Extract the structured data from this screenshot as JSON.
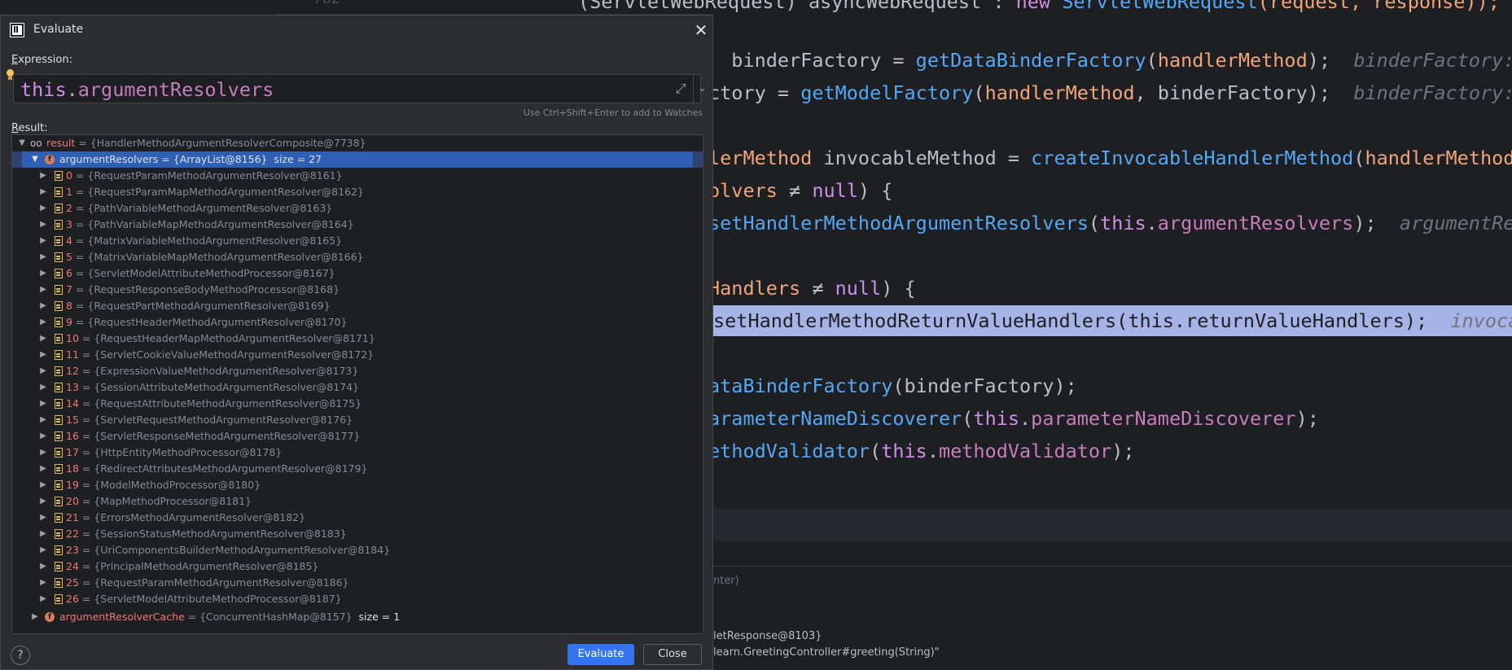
{
  "editor": {
    "top_gutter": [
      "782",
      "",
      ""
    ],
    "lines": [
      {
        "segments": [
          {
            "t": "(ServletWebRequest) asyncWebRequest : ",
            "c": ""
          },
          {
            "t": "new ",
            "c": "kw"
          },
          {
            "t": "ServletWebRequest",
            "c": "fn"
          },
          {
            "t": "(request, response));",
            "c": "par"
          }
        ]
      },
      {
        "segments": [
          {
            "t": "  binderFactory = ",
            "c": ""
          },
          {
            "t": "getDataBinderFactory",
            "c": "fn"
          },
          {
            "t": "(",
            "c": ""
          },
          {
            "t": "handlerMethod",
            "c": "par"
          },
          {
            "t": ");  ",
            "c": ""
          },
          {
            "t": "binderFactory: ",
            "c": "hint"
          }
        ]
      },
      {
        "segments": [
          {
            "t": "ctory = ",
            "c": ""
          },
          {
            "t": "getModelFactory",
            "c": "fn"
          },
          {
            "t": "(",
            "c": ""
          },
          {
            "t": "handlerMethod",
            "c": "par"
          },
          {
            "t": ", binderFactory);  ",
            "c": ""
          },
          {
            "t": "binderFactory:",
            "c": "hint"
          }
        ]
      },
      {
        "segments": [
          {
            "t": "lerMethod",
            "c": "par"
          },
          {
            "t": " invocableMethod = ",
            "c": ""
          },
          {
            "t": "createInvocableHandlerMethod",
            "c": "fn"
          },
          {
            "t": "(",
            "c": ""
          },
          {
            "t": "handlerMethod",
            "c": "par"
          }
        ]
      },
      {
        "segments": [
          {
            "t": "olvers",
            "c": "par"
          },
          {
            "t": " ≠ ",
            "c": ""
          },
          {
            "t": "null",
            "c": "kw"
          },
          {
            "t": ") {",
            "c": ""
          }
        ]
      },
      {
        "segments": [
          {
            "t": "setHandlerMethodArgumentResolvers",
            "c": "fn"
          },
          {
            "t": "(",
            "c": ""
          },
          {
            "t": "this",
            "c": "kw"
          },
          {
            "t": ".",
            "c": ""
          },
          {
            "t": "argumentResolvers",
            "c": "fld"
          },
          {
            "t": ");  ",
            "c": ""
          },
          {
            "t": "argumentRe",
            "c": "hint"
          }
        ]
      },
      {
        "segments": [
          {
            "t": "Handlers",
            "c": "par"
          },
          {
            "t": " ≠ ",
            "c": ""
          },
          {
            "t": "null",
            "c": "kw"
          },
          {
            "t": ") {",
            "c": ""
          }
        ]
      },
      {
        "segments": [
          {
            "t": "setHandlerMethodReturnValueHandlers(this.returnValueHandlers);  ",
            "c": "dark"
          },
          {
            "t": "invoca",
            "c": "hint"
          }
        ]
      },
      {
        "segments": [
          {
            "t": "ataBinderFactory",
            "c": "fn"
          },
          {
            "t": "(binderFactory);",
            "c": ""
          }
        ]
      },
      {
        "segments": [
          {
            "t": "arameterNameDiscoverer",
            "c": "fn"
          },
          {
            "t": "(",
            "c": ""
          },
          {
            "t": "this",
            "c": "kw"
          },
          {
            "t": ".",
            "c": ""
          },
          {
            "t": "parameterNameDiscoverer",
            "c": "fld"
          },
          {
            "t": ");",
            "c": ""
          }
        ]
      },
      {
        "segments": [
          {
            "t": "ethodValidator",
            "c": "fn"
          },
          {
            "t": "(",
            "c": ""
          },
          {
            "t": "this",
            "c": "kw"
          },
          {
            "t": ".",
            "c": ""
          },
          {
            "t": "methodValidator",
            "c": "fld"
          },
          {
            "t": ");",
            "c": ""
          }
        ]
      }
    ],
    "bottom_panel": {
      "hint": "nter)",
      "line1": "letResponse@8103}",
      "line2": "learn.GreetingController#greeting(String)\""
    }
  },
  "dialog": {
    "title": "Evaluate",
    "expression_label_prefix": "E",
    "expression_label_rest": "xpression:",
    "expression": {
      "keyword": "this",
      "dot": ".",
      "field": "argumentResolvers"
    },
    "watch_hint": "Use Ctrl+Shift+Enter to add to Watches",
    "result_label_prefix": "R",
    "result_label_rest": "esult:",
    "evaluate_button": "Evaluate",
    "close_button": "Close",
    "help": "?"
  },
  "tree": {
    "root": {
      "name": "result",
      "value": " = {HandlerMethodArgumentResolverComposite@7738}"
    },
    "selected": {
      "name": "argumentResolvers",
      "value": " = {ArrayList@8156}",
      "size": "  size = 27"
    },
    "items": [
      {
        "idx": "0",
        "value": " = {RequestParamMethodArgumentResolver@8161}"
      },
      {
        "idx": "1",
        "value": " = {RequestParamMapMethodArgumentResolver@8162}"
      },
      {
        "idx": "2",
        "value": " = {PathVariableMethodArgumentResolver@8163}"
      },
      {
        "idx": "3",
        "value": " = {PathVariableMapMethodArgumentResolver@8164}"
      },
      {
        "idx": "4",
        "value": " = {MatrixVariableMethodArgumentResolver@8165}"
      },
      {
        "idx": "5",
        "value": " = {MatrixVariableMapMethodArgumentResolver@8166}"
      },
      {
        "idx": "6",
        "value": " = {ServletModelAttributeMethodProcessor@8167}"
      },
      {
        "idx": "7",
        "value": " = {RequestResponseBodyMethodProcessor@8168}"
      },
      {
        "idx": "8",
        "value": " = {RequestPartMethodArgumentResolver@8169}"
      },
      {
        "idx": "9",
        "value": " = {RequestHeaderMethodArgumentResolver@8170}"
      },
      {
        "idx": "10",
        "value": " = {RequestHeaderMapMethodArgumentResolver@8171}"
      },
      {
        "idx": "11",
        "value": " = {ServletCookieValueMethodArgumentResolver@8172}"
      },
      {
        "idx": "12",
        "value": " = {ExpressionValueMethodArgumentResolver@8173}"
      },
      {
        "idx": "13",
        "value": " = {SessionAttributeMethodArgumentResolver@8174}"
      },
      {
        "idx": "14",
        "value": " = {RequestAttributeMethodArgumentResolver@8175}"
      },
      {
        "idx": "15",
        "value": " = {ServletRequestMethodArgumentResolver@8176}"
      },
      {
        "idx": "16",
        "value": " = {ServletResponseMethodArgumentResolver@8177}"
      },
      {
        "idx": "17",
        "value": " = {HttpEntityMethodProcessor@8178}"
      },
      {
        "idx": "18",
        "value": " = {RedirectAttributesMethodArgumentResolver@8179}"
      },
      {
        "idx": "19",
        "value": " = {ModelMethodProcessor@8180}"
      },
      {
        "idx": "20",
        "value": " = {MapMethodProcessor@8181}"
      },
      {
        "idx": "21",
        "value": " = {ErrorsMethodArgumentResolver@8182}"
      },
      {
        "idx": "22",
        "value": " = {SessionStatusMethodArgumentResolver@8183}"
      },
      {
        "idx": "23",
        "value": " = {UriComponentsBuilderMethodArgumentResolver@8184}"
      },
      {
        "idx": "24",
        "value": " = {PrincipalMethodArgumentResolver@8185}"
      },
      {
        "idx": "25",
        "value": " = {RequestParamMethodArgumentResolver@8186}"
      },
      {
        "idx": "26",
        "value": " = {ServletModelAttributeMethodProcessor@8187}"
      }
    ],
    "last": {
      "name": "argumentResolverCache",
      "value": " = {ConcurrentHashMap@8157}",
      "size": "  size = 1"
    }
  },
  "colors": {
    "accent": "#3574f0",
    "selection": "#2e5fb5",
    "field_icon": "#d67e5c",
    "array_icon": "#e5b849"
  }
}
